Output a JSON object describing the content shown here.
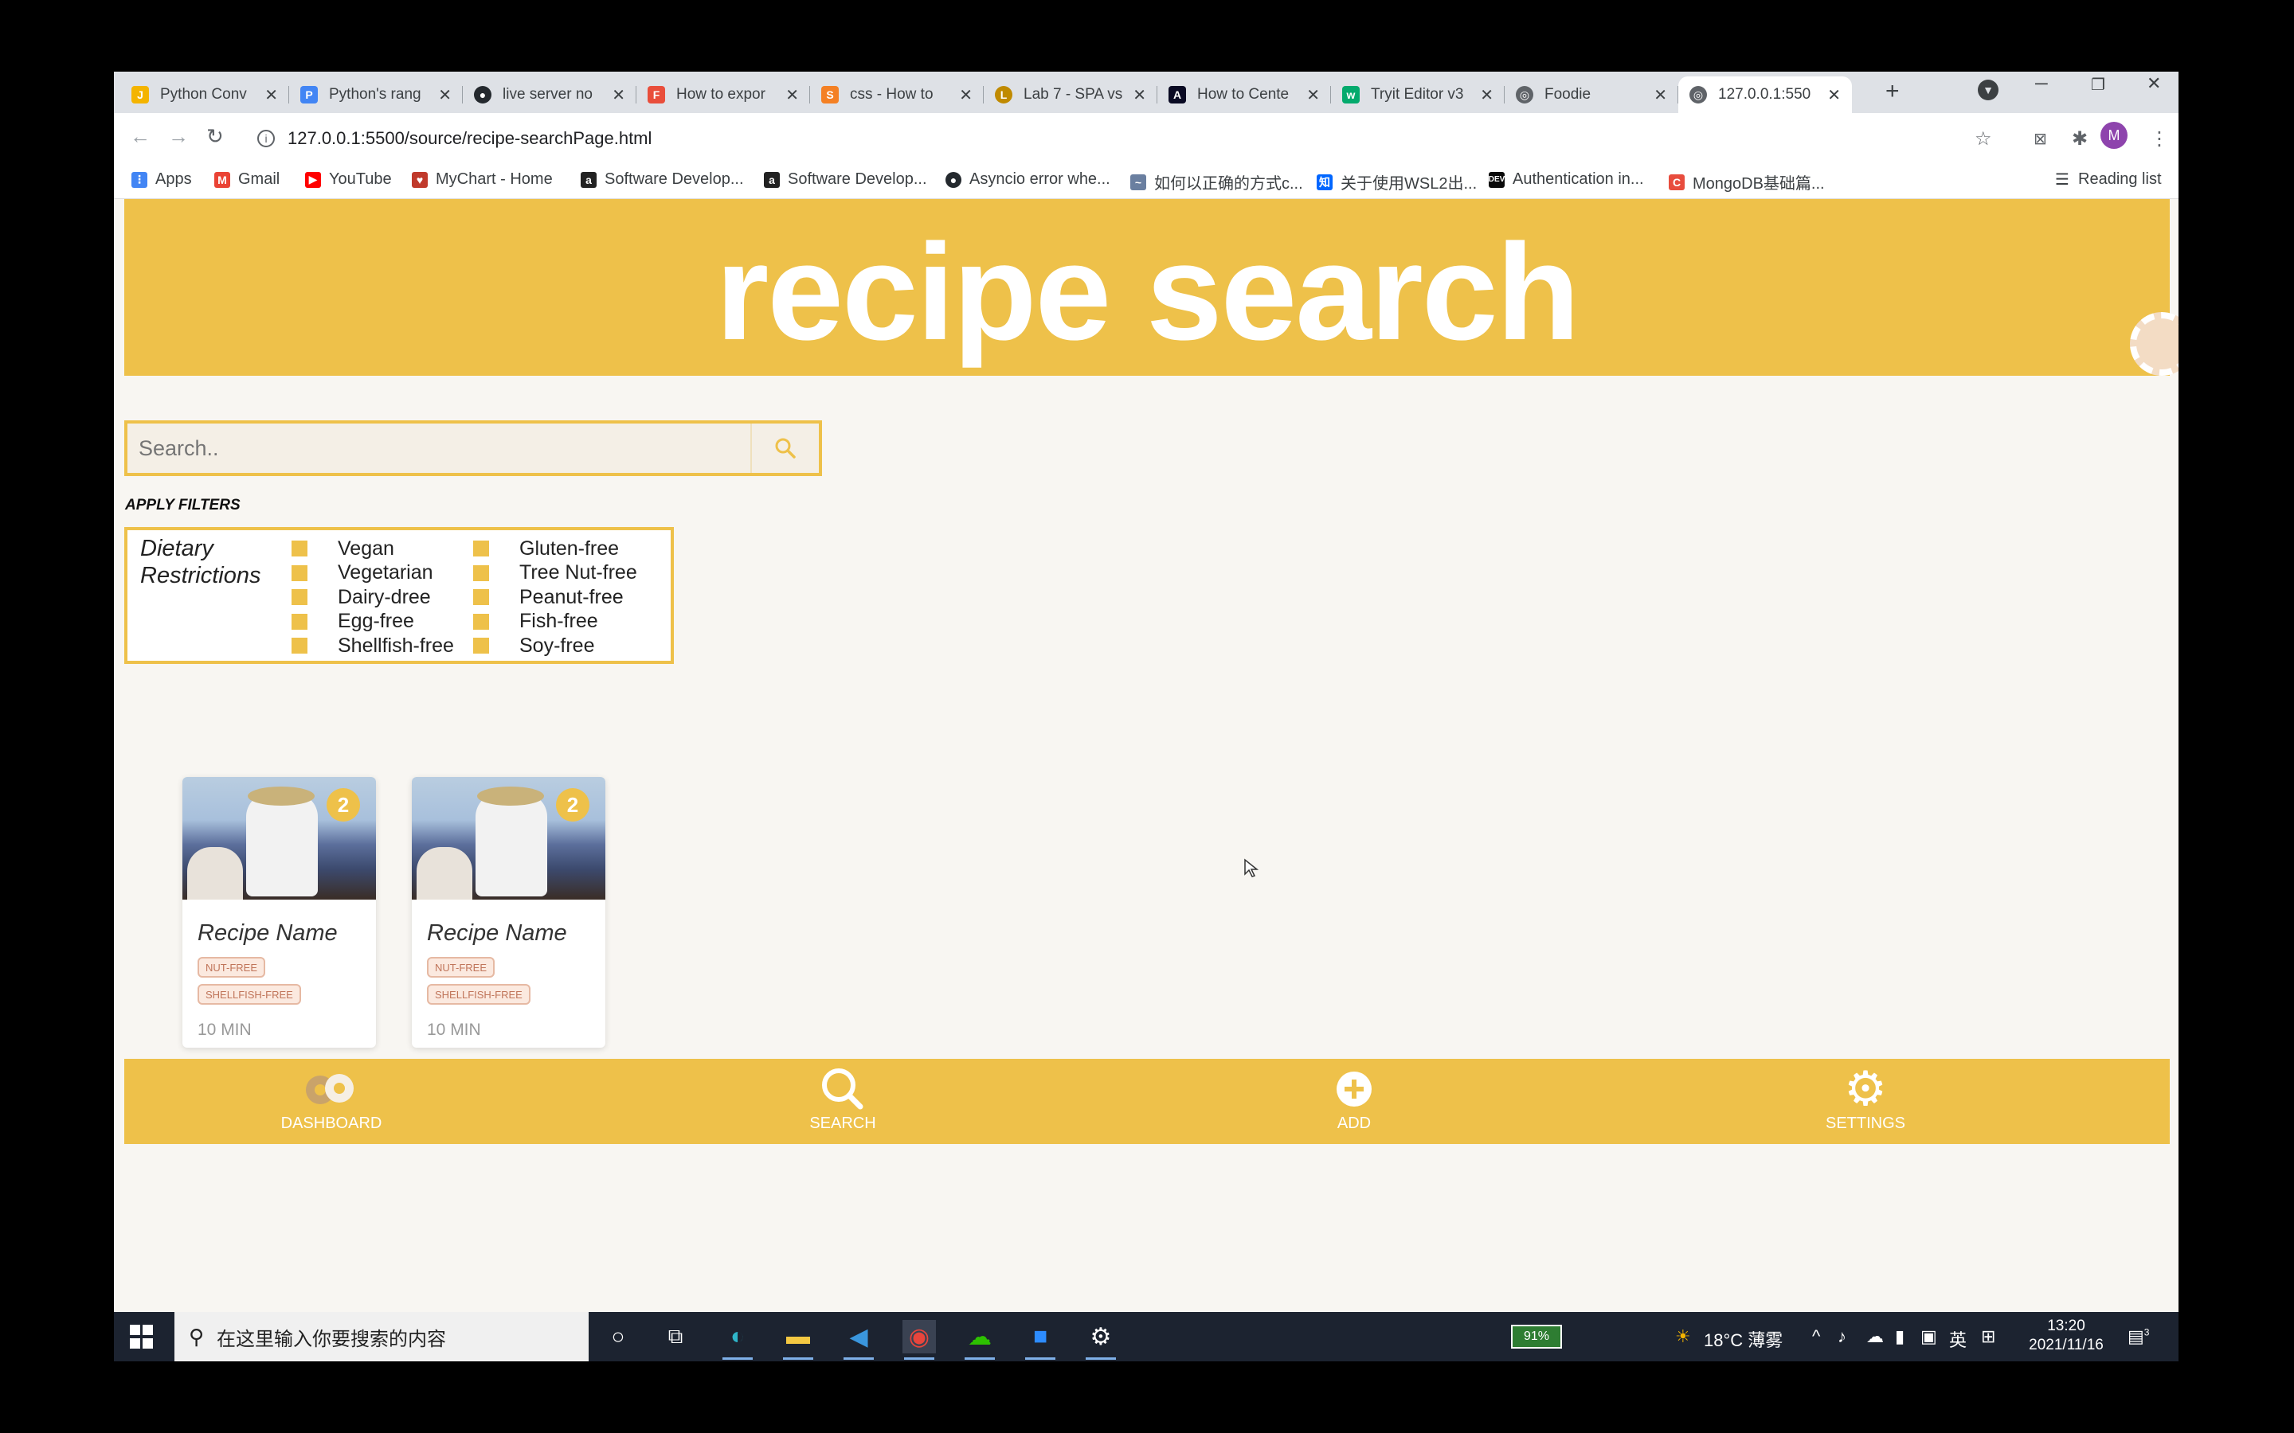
{
  "browser": {
    "tabs": [
      {
        "title": "Python Conv",
        "color": "#f4b400"
      },
      {
        "title": "Python's rang",
        "color": "#4285f4"
      },
      {
        "title": "live server no",
        "color": "#24292e"
      },
      {
        "title": "How to expor",
        "color": "#e94e3b"
      },
      {
        "title": "css - How to",
        "color": "#f48024"
      },
      {
        "title": "Lab 7 - SPA vs",
        "color": "#c08a00"
      },
      {
        "title": "How to Cente",
        "color": "#0a0a23"
      },
      {
        "title": "Tryit Editor v3",
        "color": "#04aa6d"
      },
      {
        "title": "Foodie",
        "color": "#5f6368"
      },
      {
        "title": "127.0.0.1:550",
        "color": "#5f6368"
      }
    ],
    "url": "127.0.0.1:5500/source/recipe-searchPage.html",
    "avatar_letter": "M",
    "bookmarks": [
      {
        "label": "Apps",
        "color": "#4285f4"
      },
      {
        "label": "Gmail",
        "color": "#ea4335"
      },
      {
        "label": "YouTube",
        "color": "#ff0000"
      },
      {
        "label": "MyChart - Home",
        "color": "#c0392b"
      },
      {
        "label": "Software Develop...",
        "color": "#222222"
      },
      {
        "label": "Software Develop...",
        "color": "#222222"
      },
      {
        "label": "Asyncio error whe...",
        "color": "#24292e"
      },
      {
        "label": "如何以正确的方式c...",
        "color": "#6a7fa0"
      },
      {
        "label": "关于使用WSL2出...",
        "color": "#0066ff"
      },
      {
        "label": "Authentication in...",
        "color": "#0a0a0a"
      },
      {
        "label": "MongoDB基础篇...",
        "color": "#e84c3d"
      }
    ],
    "reading_list": "Reading list"
  },
  "page": {
    "title": "recipe search",
    "search_placeholder": "Search..",
    "apply_filters": "APPLY FILTERS",
    "filters": {
      "label": "Dietary Restrictions",
      "col1": [
        "Vegan",
        "Vegetarian",
        "Dairy-dree",
        "Egg-free",
        "Shellfish-free"
      ],
      "col2": [
        "Gluten-free",
        "Tree Nut-free",
        "Peanut-free",
        "Fish-free",
        "Soy-free"
      ]
    },
    "cards": [
      {
        "badge": "2",
        "name": "Recipe Name",
        "tags": [
          "NUT-FREE",
          "SHELLFISH-FREE"
        ],
        "time": "10 MIN"
      },
      {
        "badge": "2",
        "name": "Recipe Name",
        "tags": [
          "NUT-FREE",
          "SHELLFISH-FREE"
        ],
        "time": "10 MIN"
      }
    ],
    "nav": {
      "dashboard": "DASHBOARD",
      "search": "SEARCH",
      "add": "ADD",
      "settings": "SETTINGS"
    },
    "accent_color": "#eec14a"
  },
  "taskbar": {
    "search_placeholder": "在这里输入你要搜索的内容",
    "battery": "91%",
    "weather": "18°C 薄雾",
    "ime": "英",
    "time": "13:20",
    "date": "2021/11/16",
    "notifications": "3"
  }
}
